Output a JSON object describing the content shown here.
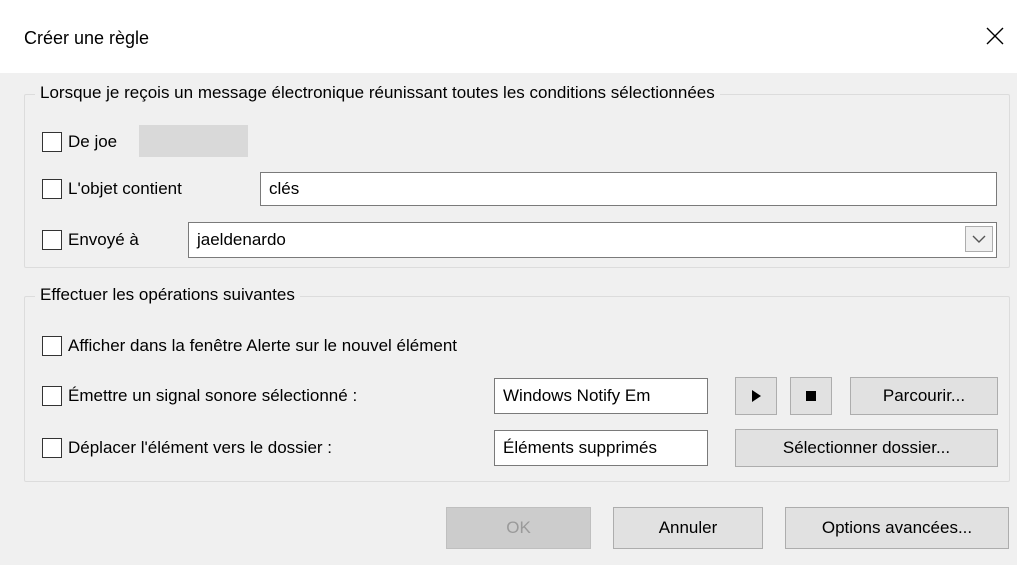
{
  "dialog": {
    "title": "Créer une règle"
  },
  "conditions": {
    "legend": "Lorsque je reçois un message électronique réunissant toutes les conditions sélectionnées",
    "from_label": "De joe",
    "subject_label": "L'objet contient",
    "subject_value": "clés",
    "sent_to_label": "Envoyé à",
    "sent_to_value": "jaeldenardo"
  },
  "actions": {
    "legend": "Effectuer les opérations suivantes",
    "alert_label": "Afficher dans la fenêtre Alerte sur le nouvel élément",
    "sound_label": "Émettre un signal sonore sélectionné :",
    "sound_value": "Windows Notify Em",
    "browse_label": "Parcourir...",
    "move_label": "Déplacer l'élément vers le dossier :",
    "folder_value": "Éléments supprimés",
    "select_folder_label": "Sélectionner dossier..."
  },
  "footer": {
    "ok_label": "OK",
    "cancel_label": "Annuler",
    "advanced_label": "Options avancées..."
  },
  "icons": {
    "close": "close-icon",
    "dropdown": "chevron-down-icon",
    "play": "play-icon",
    "stop": "stop-icon"
  }
}
